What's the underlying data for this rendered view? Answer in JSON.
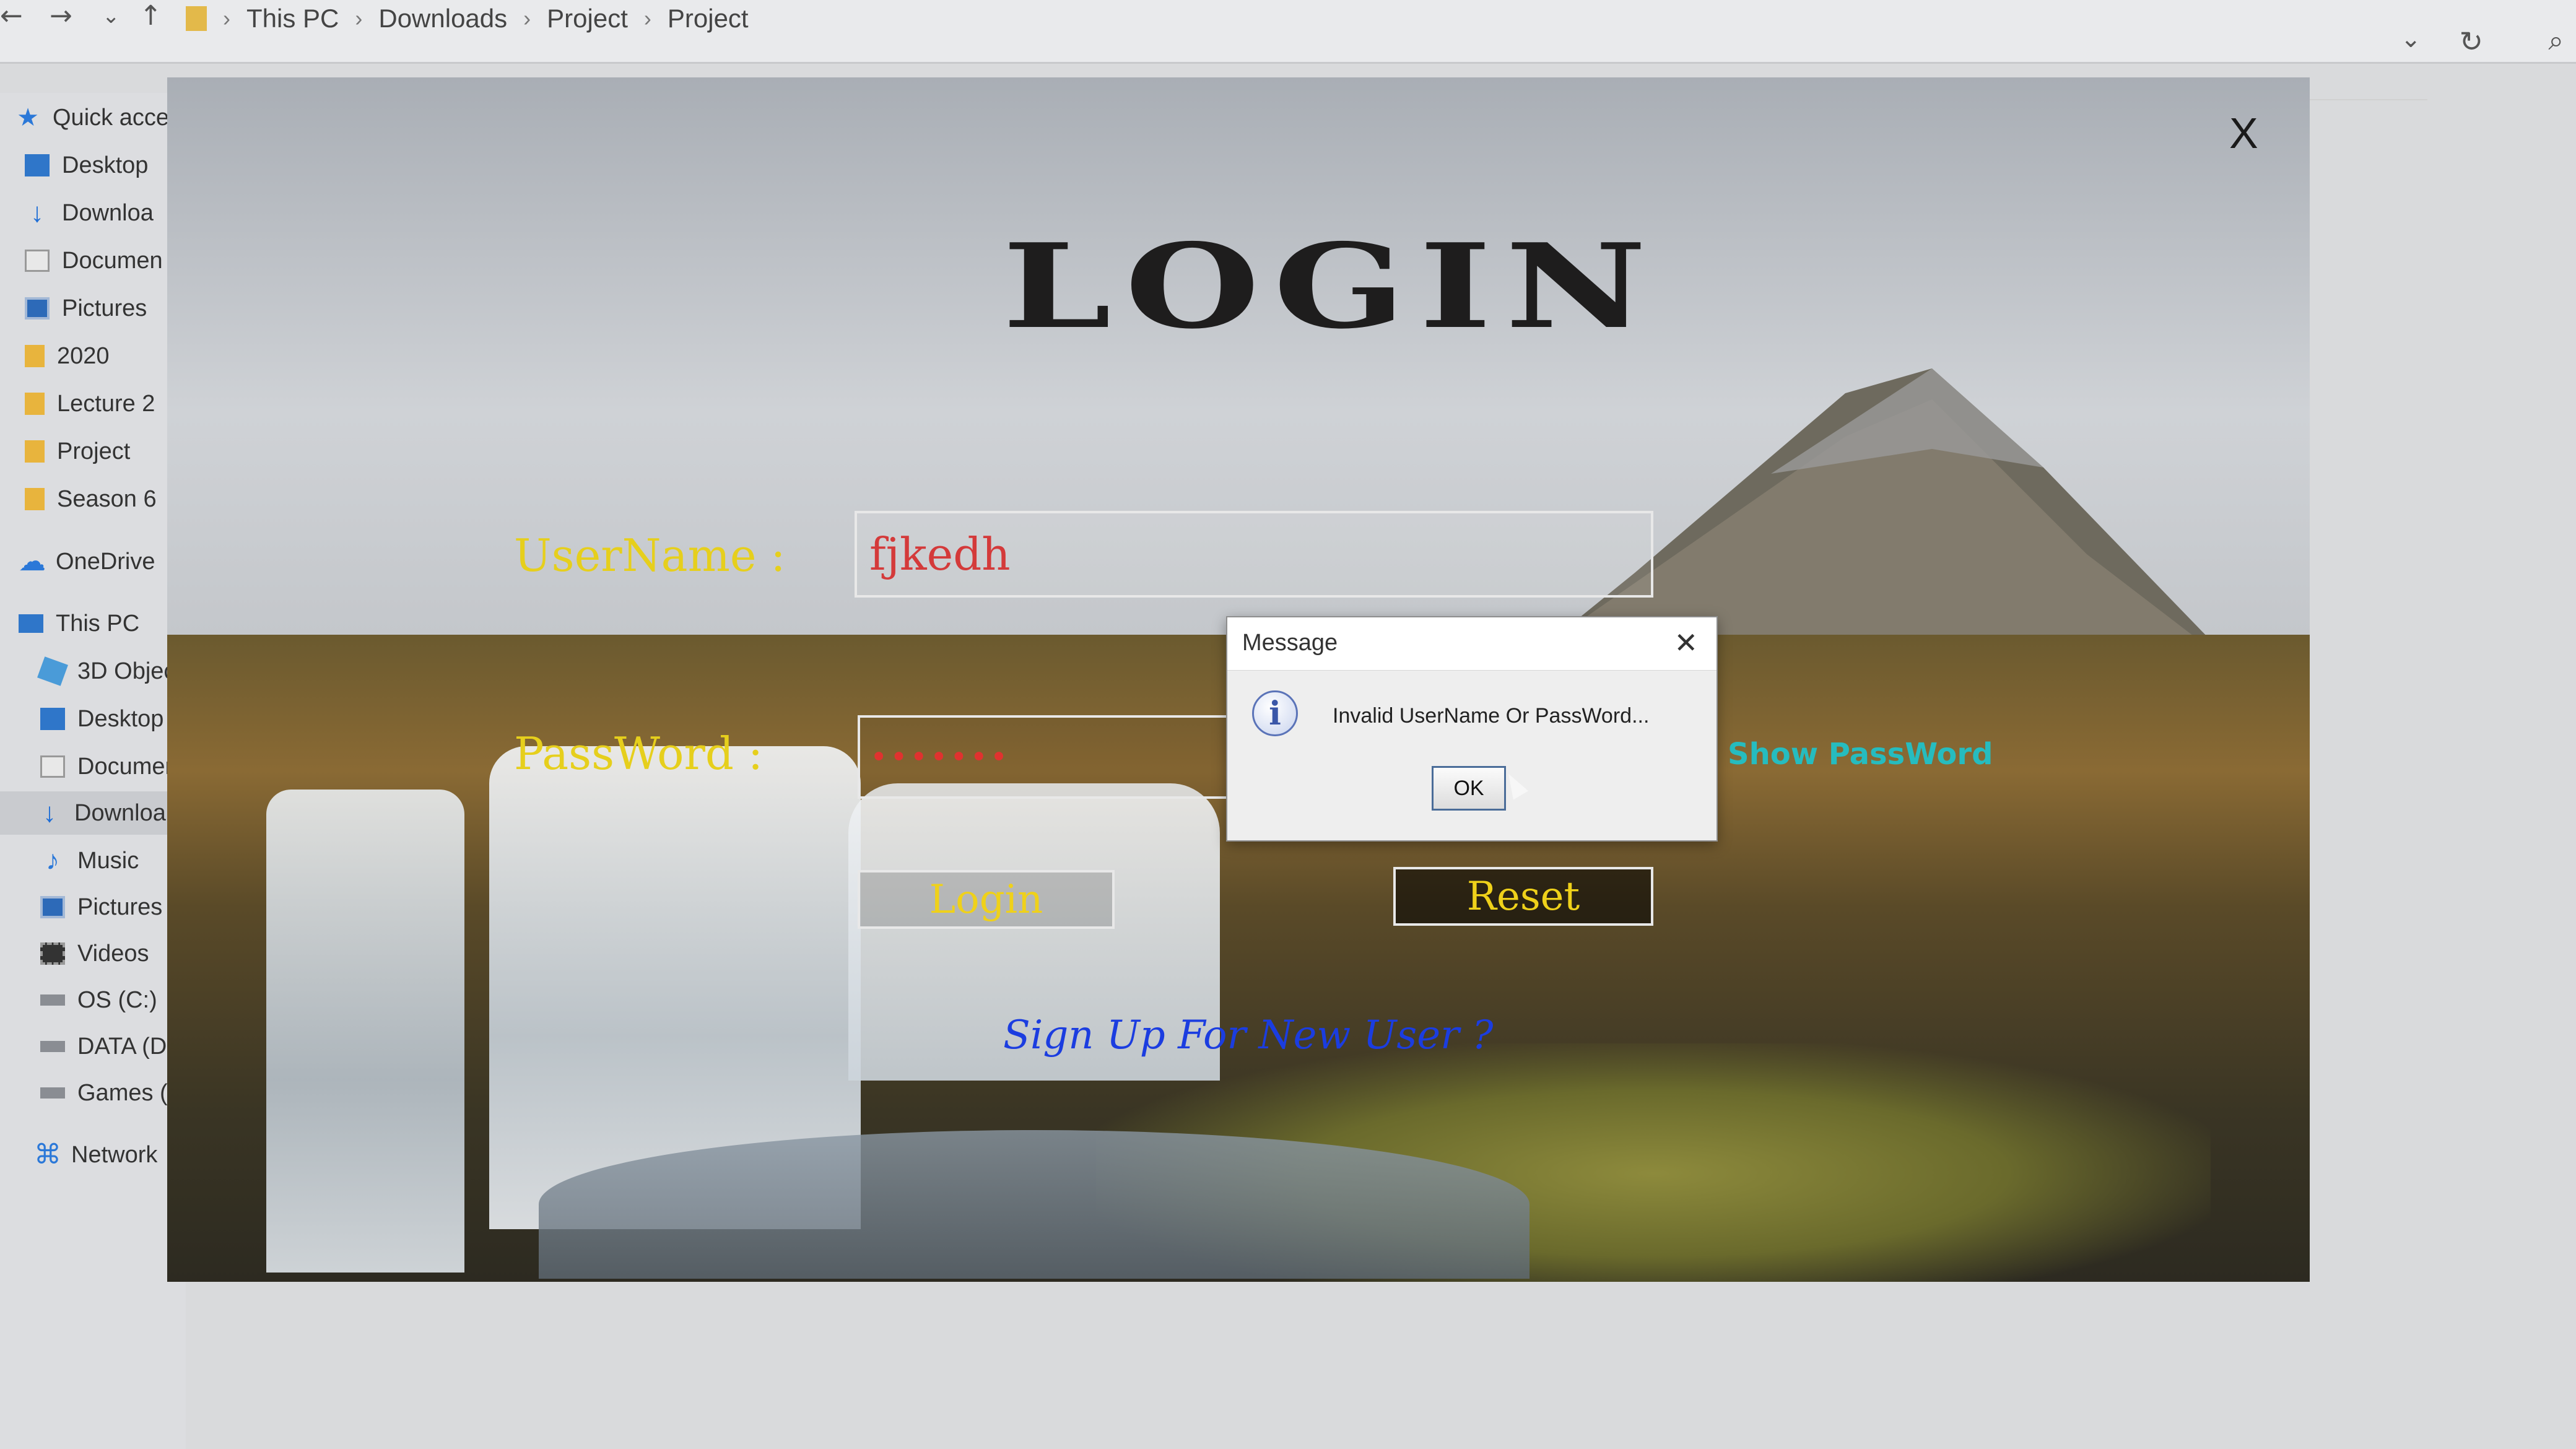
{
  "explorer": {
    "breadcrumbs": [
      "This PC",
      "Downloads",
      "Project",
      "Project"
    ],
    "sidebar": [
      {
        "label": "Quick acce",
        "icon": "star-icon"
      },
      {
        "label": "Desktop",
        "icon": "desktop-icon"
      },
      {
        "label": "Downloa",
        "icon": "download-icon"
      },
      {
        "label": "Documen",
        "icon": "documents-icon"
      },
      {
        "label": "Pictures",
        "icon": "pictures-icon"
      },
      {
        "label": "2020",
        "icon": "folder-icon"
      },
      {
        "label": "Lecture 2",
        "icon": "folder-icon"
      },
      {
        "label": "Project",
        "icon": "folder-icon"
      },
      {
        "label": "Season 6",
        "icon": "folder-icon"
      },
      {
        "label": "OneDrive",
        "icon": "cloud-icon"
      },
      {
        "label": "This PC",
        "icon": "computer-icon"
      },
      {
        "label": "3D Objec",
        "icon": "cube-icon"
      },
      {
        "label": "Desktop",
        "icon": "desktop-icon"
      },
      {
        "label": "Documen",
        "icon": "documents-icon"
      },
      {
        "label": "Downloa",
        "icon": "download-icon"
      },
      {
        "label": "Music",
        "icon": "music-icon"
      },
      {
        "label": "Pictures",
        "icon": "pictures-icon"
      },
      {
        "label": "Videos",
        "icon": "videos-icon"
      },
      {
        "label": "OS (C:)",
        "icon": "drive-icon"
      },
      {
        "label": "DATA (D:",
        "icon": "drive-icon"
      },
      {
        "label": "Games (H",
        "icon": "drive-icon"
      },
      {
        "label": "Network",
        "icon": "network-icon"
      }
    ]
  },
  "login": {
    "title": "LOGIN",
    "close_label": "X",
    "username_label": "UserName :",
    "username_value": "fjkedh",
    "password_label": "PassWord :",
    "password_value": "•••••••",
    "show_password": "Show PassWord",
    "login_button": "Login",
    "reset_button": "Reset",
    "signup_link": "Sign Up For New User ?"
  },
  "dialog": {
    "title": "Message",
    "close_glyph": "✕",
    "message": "Invalid UserName Or PassWord...",
    "ok_button": "OK",
    "icon": "info-icon",
    "icon_glyph": "i"
  },
  "colors": {
    "label_yellow": "#e6cf1c",
    "username_red": "#d43a3a",
    "show_password_cyan": "#26bcbf",
    "signup_blue": "#1b3de0"
  }
}
